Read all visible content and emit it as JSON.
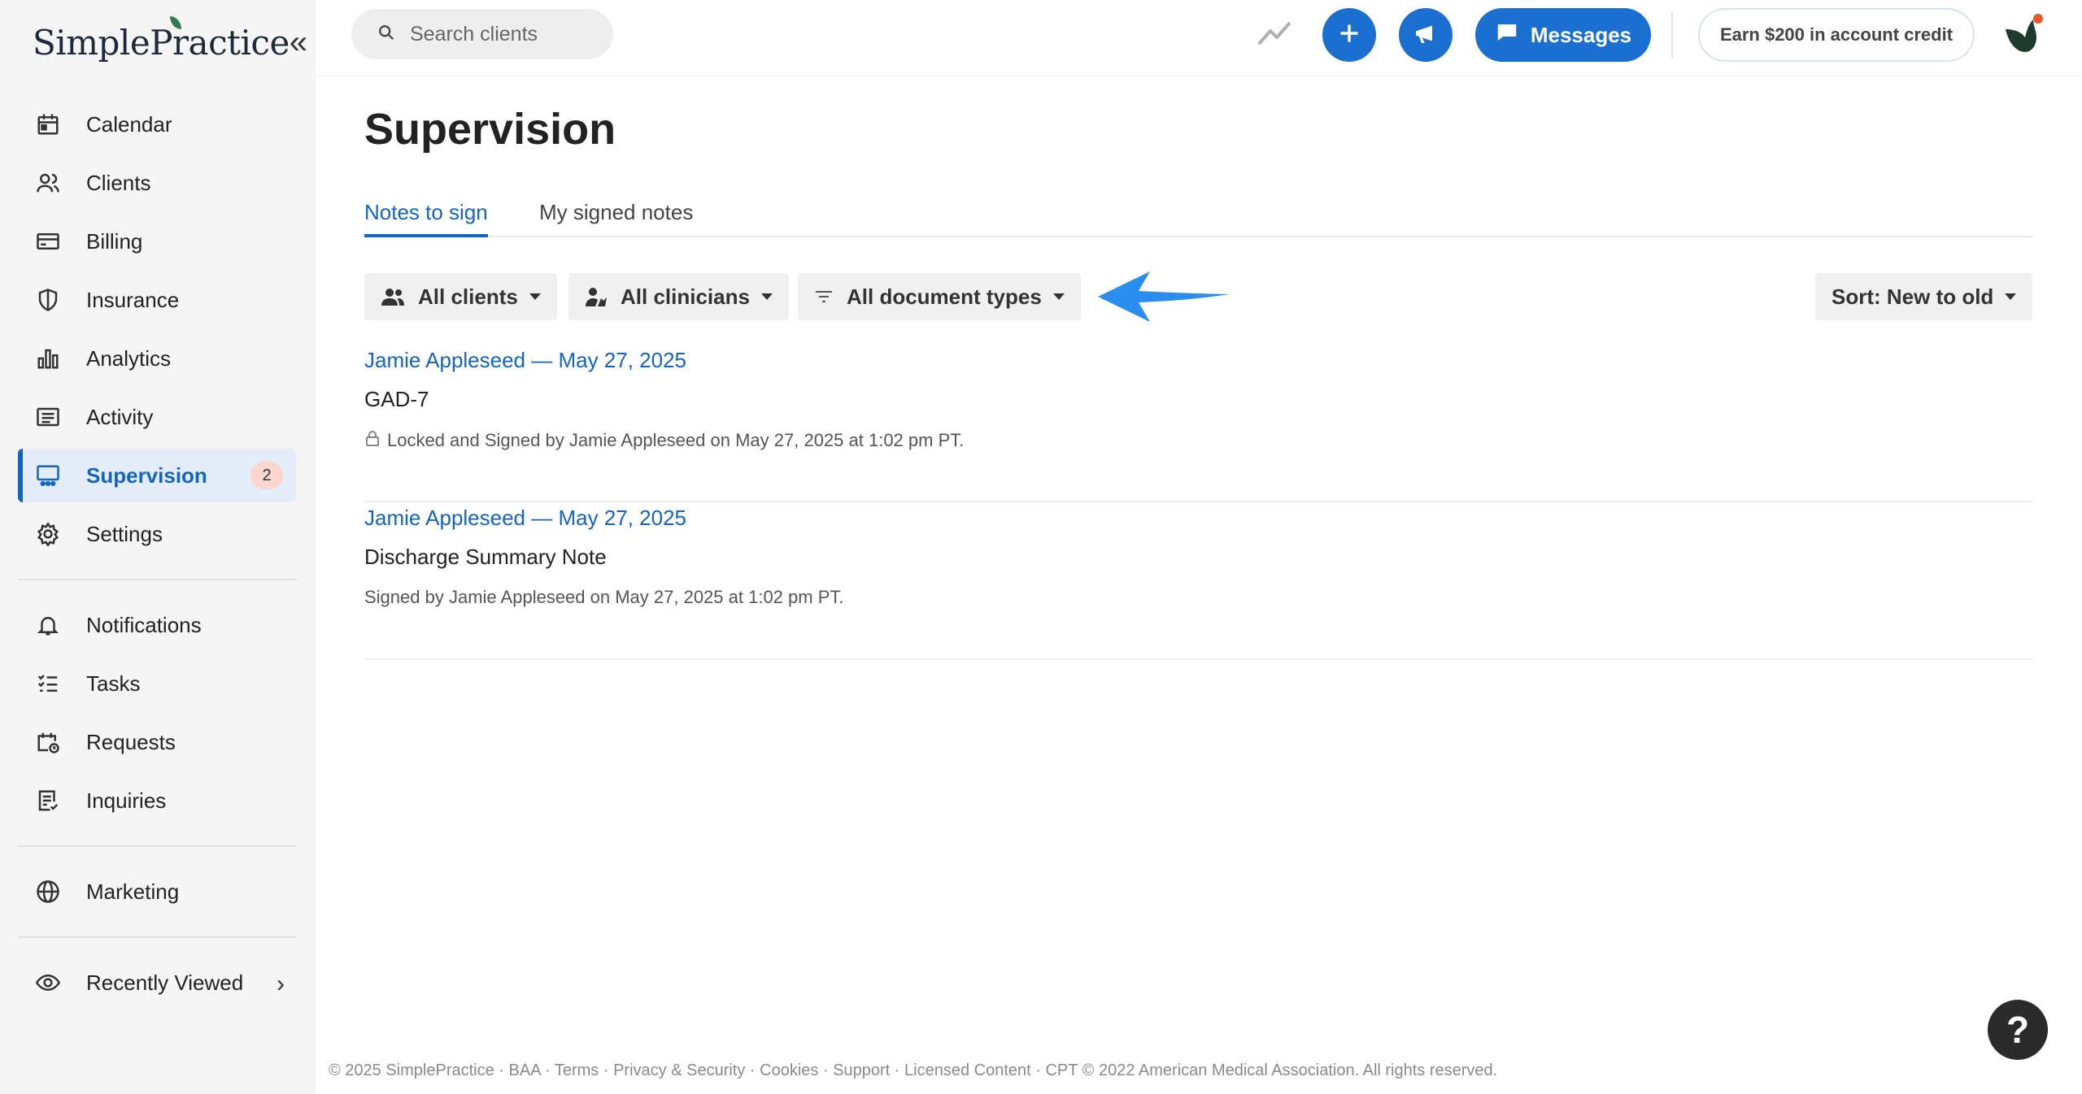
{
  "app": {
    "logo": "SimplePractice",
    "collapse_icon": "double-chevron-left-icon"
  },
  "sidebar": {
    "items": [
      {
        "label": "Calendar",
        "icon": "calendar-icon"
      },
      {
        "label": "Clients",
        "icon": "users-icon"
      },
      {
        "label": "Billing",
        "icon": "credit-card-icon"
      },
      {
        "label": "Insurance",
        "icon": "shield-icon"
      },
      {
        "label": "Analytics",
        "icon": "bar-chart-icon"
      },
      {
        "label": "Activity",
        "icon": "list-icon"
      },
      {
        "label": "Supervision",
        "icon": "supervision-icon",
        "active": true,
        "badge": "2"
      },
      {
        "label": "Settings",
        "icon": "gear-icon"
      }
    ],
    "items2": [
      {
        "label": "Notifications",
        "icon": "bell-icon"
      },
      {
        "label": "Tasks",
        "icon": "checklist-icon"
      },
      {
        "label": "Requests",
        "icon": "calendar-clock-icon"
      },
      {
        "label": "Inquiries",
        "icon": "document-list-icon"
      }
    ],
    "items3": [
      {
        "label": "Marketing",
        "icon": "globe-icon"
      }
    ],
    "recently_viewed": {
      "label": "Recently Viewed",
      "icon": "eye-icon"
    }
  },
  "topbar": {
    "search_placeholder": "Search clients",
    "messages_label": "Messages",
    "earn_label": "Earn $200 in account credit",
    "accent": "#1b6fd1"
  },
  "main": {
    "title": "Supervision",
    "tabs": [
      {
        "label": "Notes to sign",
        "active": true
      },
      {
        "label": "My signed notes",
        "active": false
      }
    ],
    "filters": {
      "clients": "All clients",
      "clinicians": "All clinicians",
      "document_types": "All document types",
      "sort": "Sort: New to old"
    },
    "notes": [
      {
        "link": "Jamie Appleseed — May 27, 2025",
        "type": "GAD-7",
        "status": "Locked and Signed by Jamie Appleseed on May 27, 2025 at 1:02 pm PT.",
        "locked": true
      },
      {
        "link": "Jamie Appleseed — May 27, 2025",
        "type": "Discharge Summary Note",
        "status": "Signed by Jamie Appleseed on May 27, 2025 at 1:02 pm PT.",
        "locked": false
      }
    ]
  },
  "footer": {
    "copyright": "© 2025 SimplePractice",
    "links": [
      "BAA",
      "Terms",
      "Privacy & Security",
      "Cookies",
      "Support",
      "Licensed Content"
    ],
    "cpt": "CPT © 2022 American Medical Association. All rights reserved."
  },
  "help_label": "?"
}
